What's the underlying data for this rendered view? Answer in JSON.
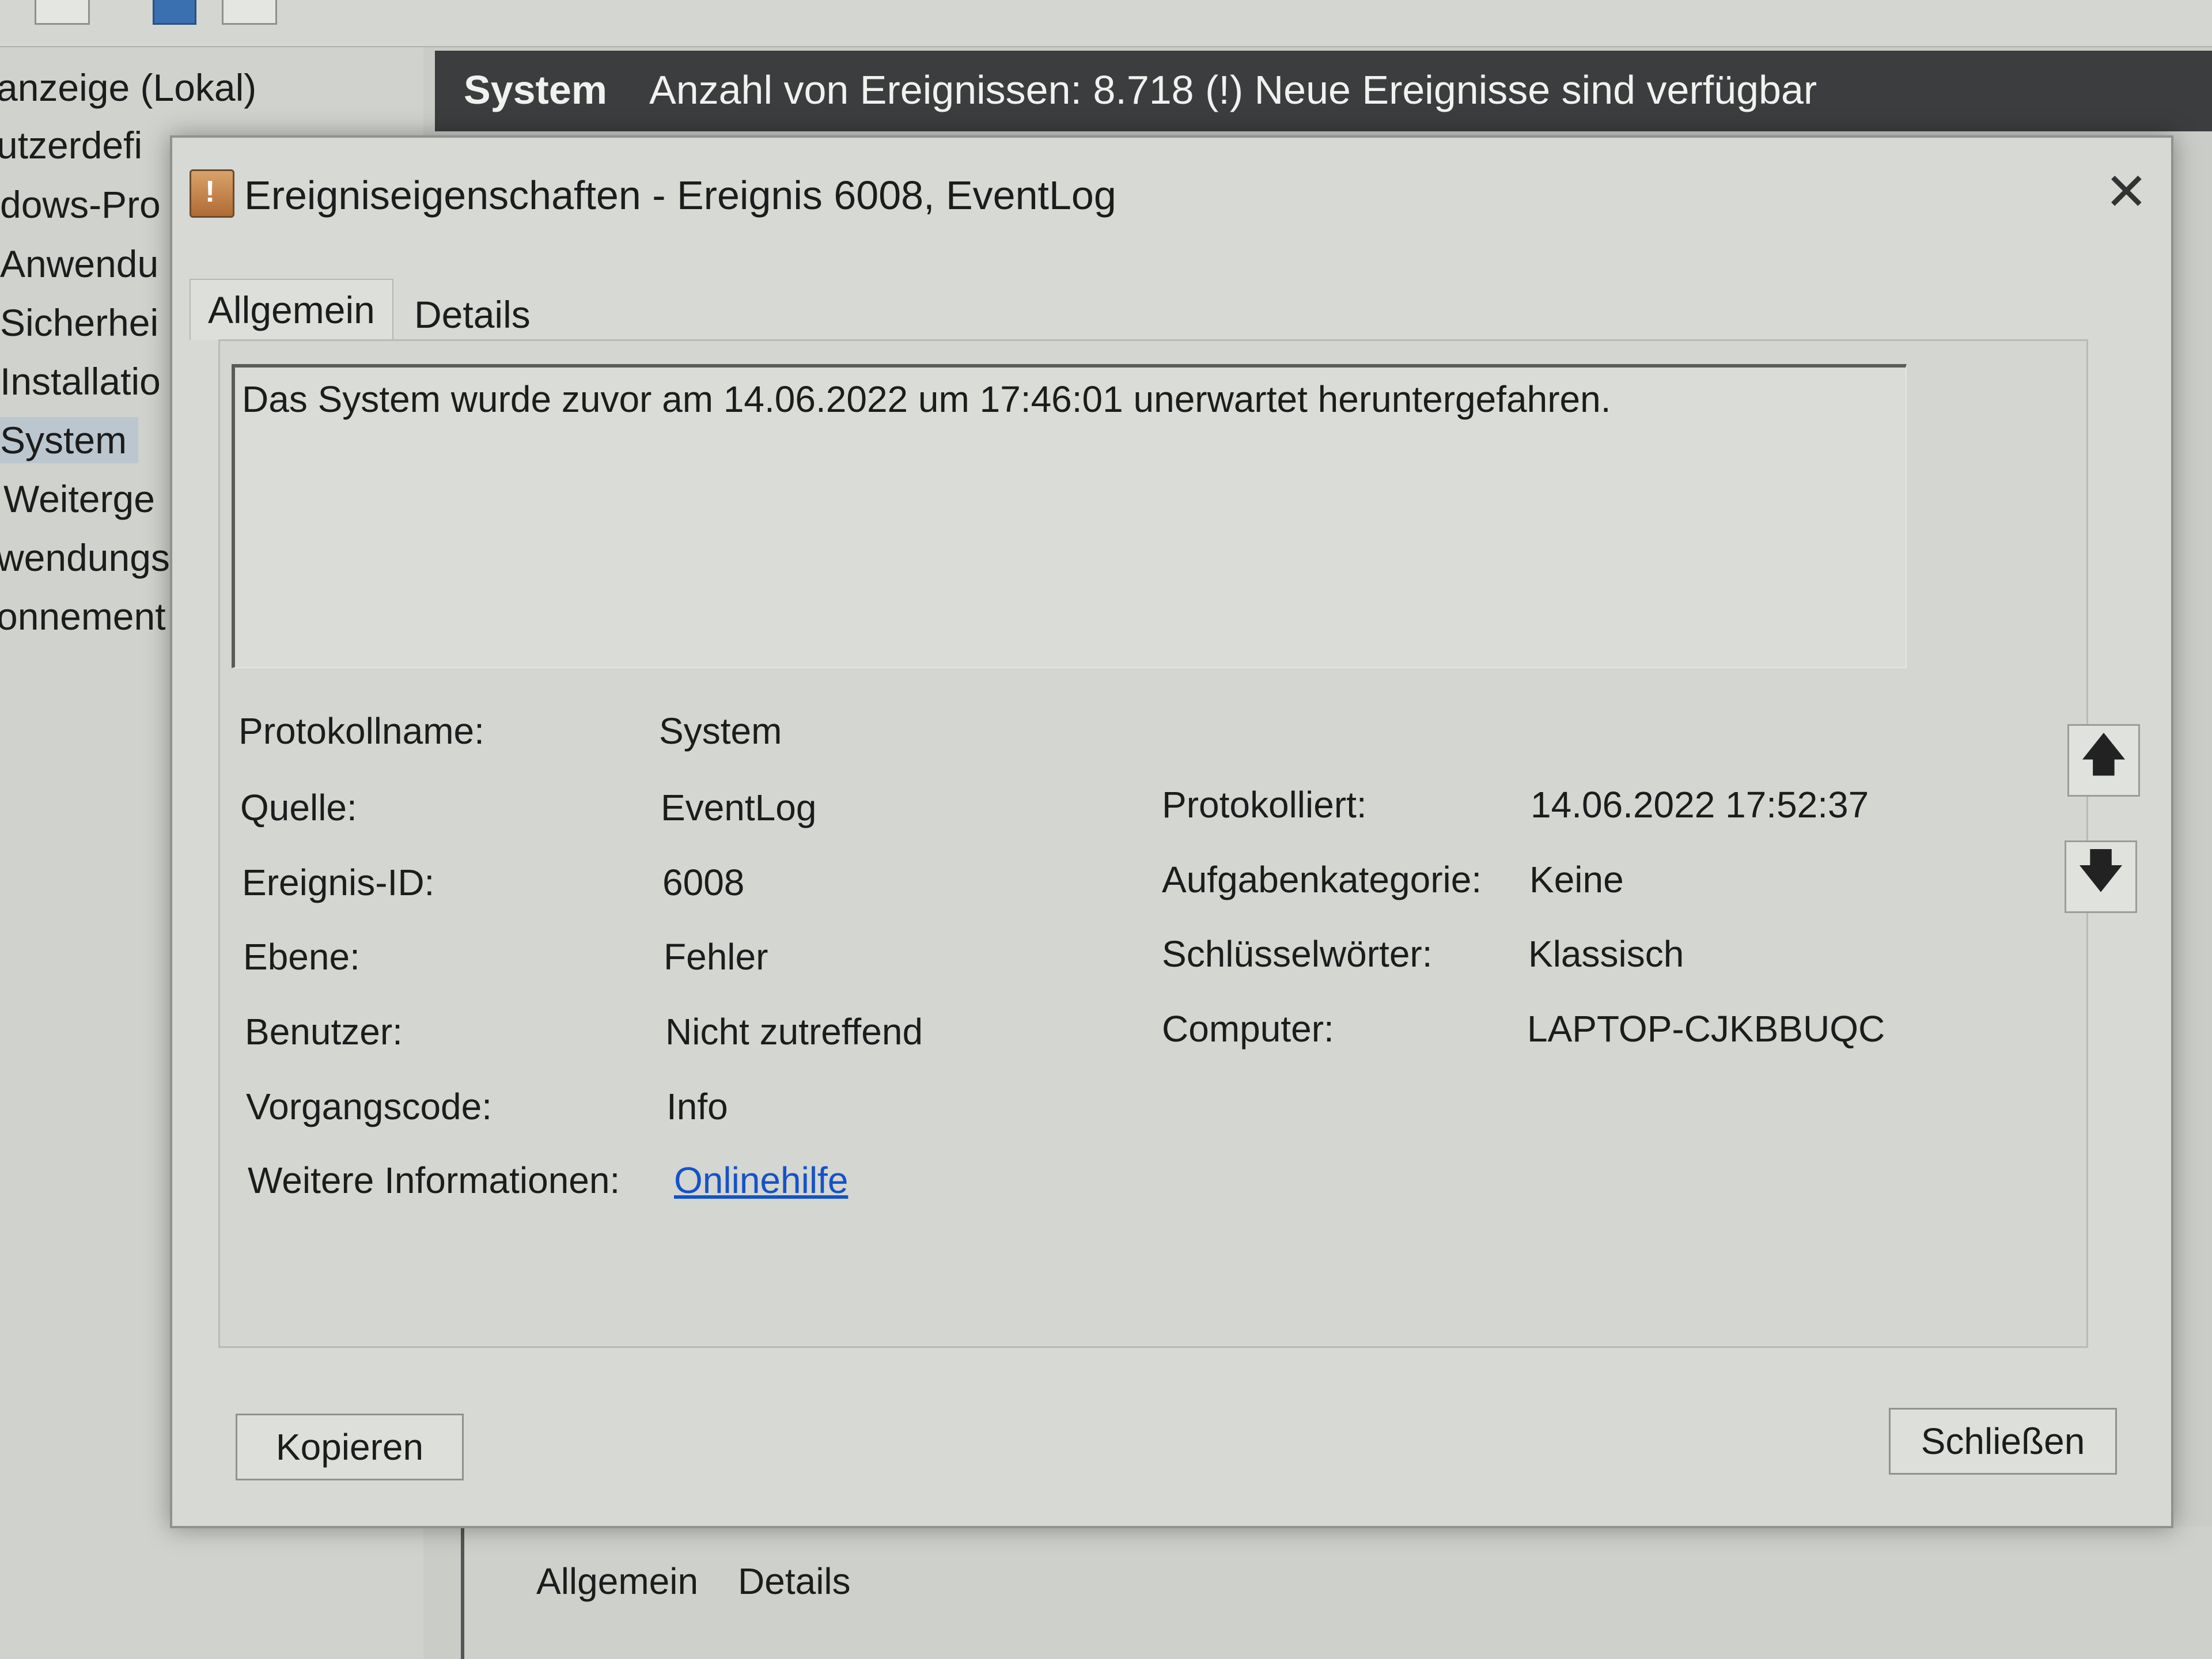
{
  "background": {
    "tree_items": [
      "anzeige (Lokal)",
      "utzerdefi",
      "dows-Pro",
      "Anwendu",
      "Sicherhei",
      "Installatio",
      "System",
      "Weiterge",
      "wendungs",
      "onnement"
    ],
    "selected_tree_item": "System",
    "header": {
      "title": "System",
      "count_text": "Anzahl von Ereignissen: 8.718 (!) Neue Ereignisse sind verfügbar"
    },
    "bottom_tabs": [
      "Allgemein",
      "Details"
    ]
  },
  "dialog": {
    "title": "Ereigniseigenschaften - Ereignis 6008, EventLog",
    "close_label": "✕",
    "tabs": [
      "Allgemein",
      "Details"
    ],
    "active_tab": "Allgemein",
    "description": "Das System wurde zuvor am 14.06.2022 um 17:46:01 unerwartet heruntergefahren.",
    "fields": {
      "protokollname": {
        "label": "Protokollname:",
        "value": "System"
      },
      "quelle": {
        "label": "Quelle:",
        "value": "EventLog"
      },
      "ereignis_id": {
        "label": "Ereignis-ID:",
        "value": "6008"
      },
      "ebene": {
        "label": "Ebene:",
        "value": "Fehler"
      },
      "benutzer": {
        "label": "Benutzer:",
        "value": "Nicht zutreffend"
      },
      "vorgangscode": {
        "label": "Vorgangscode:",
        "value": "Info"
      },
      "weitere": {
        "label": "Weitere Informationen:",
        "value": "Onlinehilfe"
      },
      "protokolliert": {
        "label": "Protokolliert:",
        "value": "14.06.2022 17:52:37"
      },
      "aufgabenkategorie": {
        "label": "Aufgabenkategorie:",
        "value": "Keine"
      },
      "schluesselwoerter": {
        "label": "Schlüsselwörter:",
        "value": "Klassisch"
      },
      "computer": {
        "label": "Computer:",
        "value": "LAPTOP-CJKBBUQC"
      }
    },
    "arrow_up": "🡅",
    "arrow_down": "🡇",
    "copy_label": "Kopieren",
    "close_button_label": "Schließen"
  }
}
